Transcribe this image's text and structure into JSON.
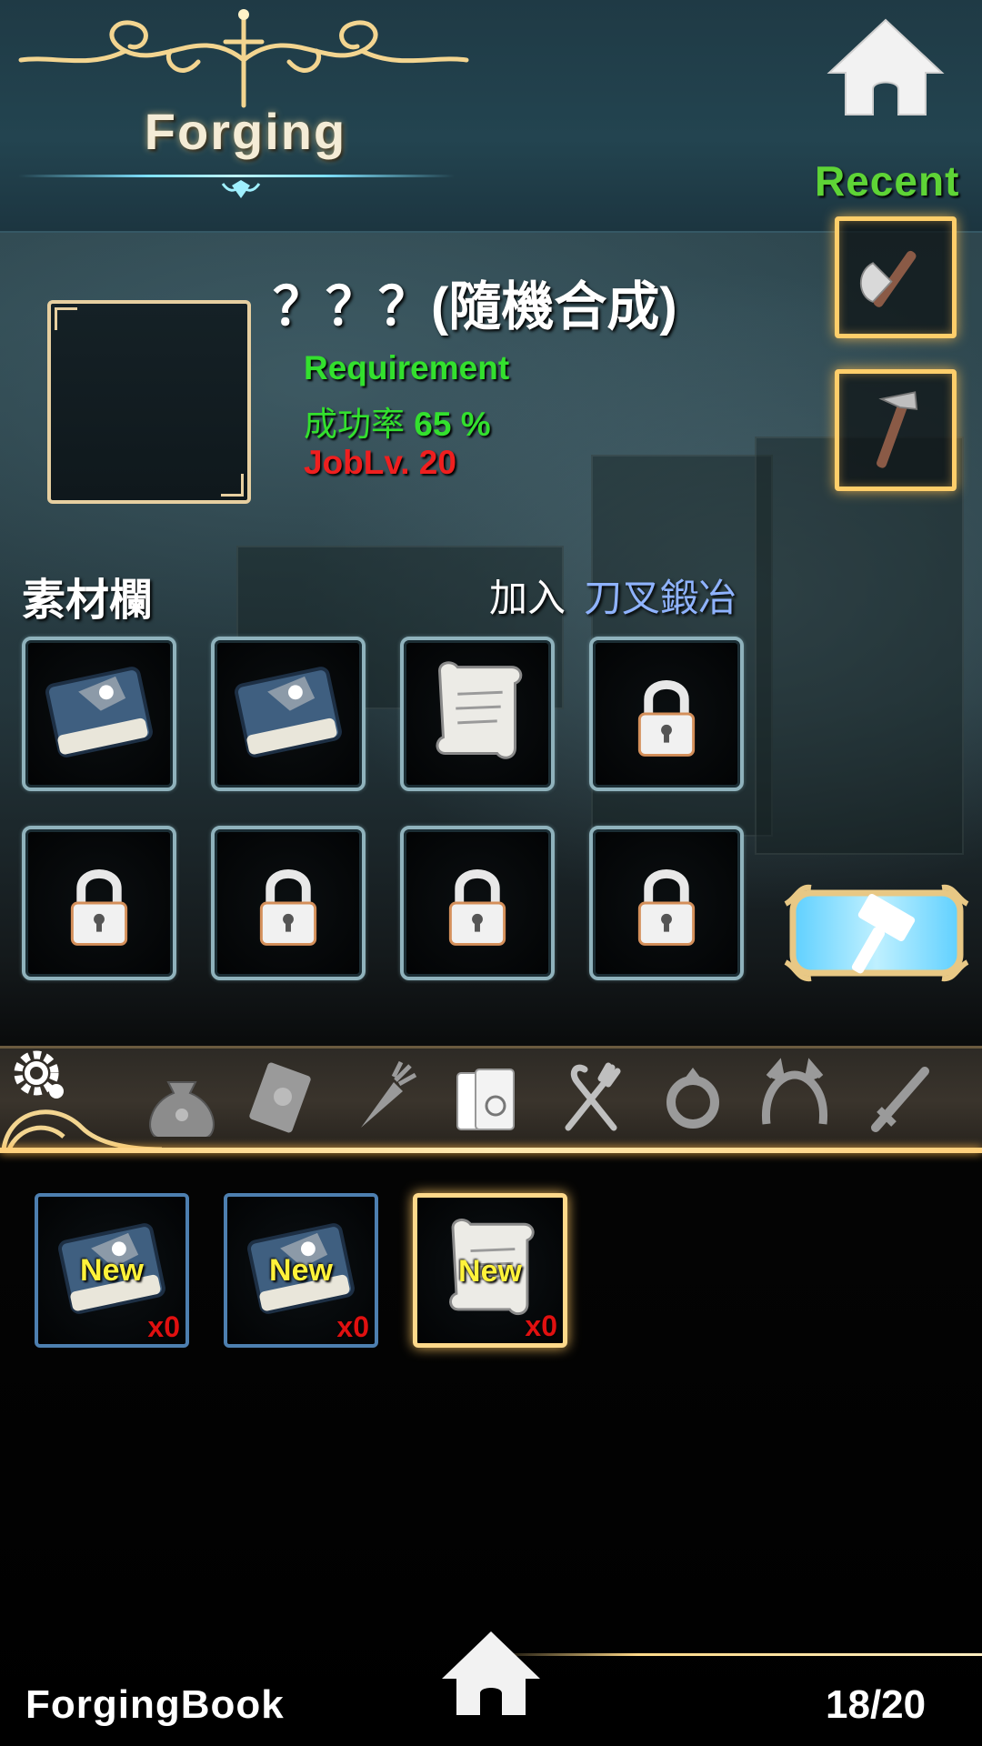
{
  "header": {
    "title": "Forging"
  },
  "recent": {
    "label": "Recent",
    "items": [
      {
        "icon": "axe-icon"
      },
      {
        "icon": "pickaxe-icon"
      }
    ]
  },
  "item": {
    "name": "？？？(隨機合成)",
    "requirement_label": "Requirement",
    "success_label": "成功率",
    "success_value": "65 %",
    "joblv": "JobLv. 20"
  },
  "materials": {
    "title": "素材欄",
    "add_label": "加入",
    "add_value": "刀叉鍛冶",
    "slots": [
      "book-icon",
      "book-icon",
      "scroll-icon",
      "lock-icon",
      "lock-icon",
      "lock-icon",
      "lock-icon",
      "lock-icon"
    ]
  },
  "categories": [
    "bag-icon",
    "card-icon",
    "carrot-icon",
    "books-icon",
    "utensils-icon",
    "ring-icon",
    "headband-icon",
    "sword-icon"
  ],
  "inventory": [
    {
      "icon": "book-icon",
      "badge": "New",
      "qty": "x0"
    },
    {
      "icon": "book-icon",
      "badge": "New",
      "qty": "x0"
    },
    {
      "icon": "scroll-icon",
      "badge": "New",
      "qty": "x0"
    }
  ],
  "footer": {
    "left": "ForgingBook",
    "right": "18/20"
  },
  "colors": {
    "accent_gold": "#ffce6a",
    "green": "#33e02e",
    "red": "#ef1f1f",
    "blue": "#8fb3ff"
  }
}
